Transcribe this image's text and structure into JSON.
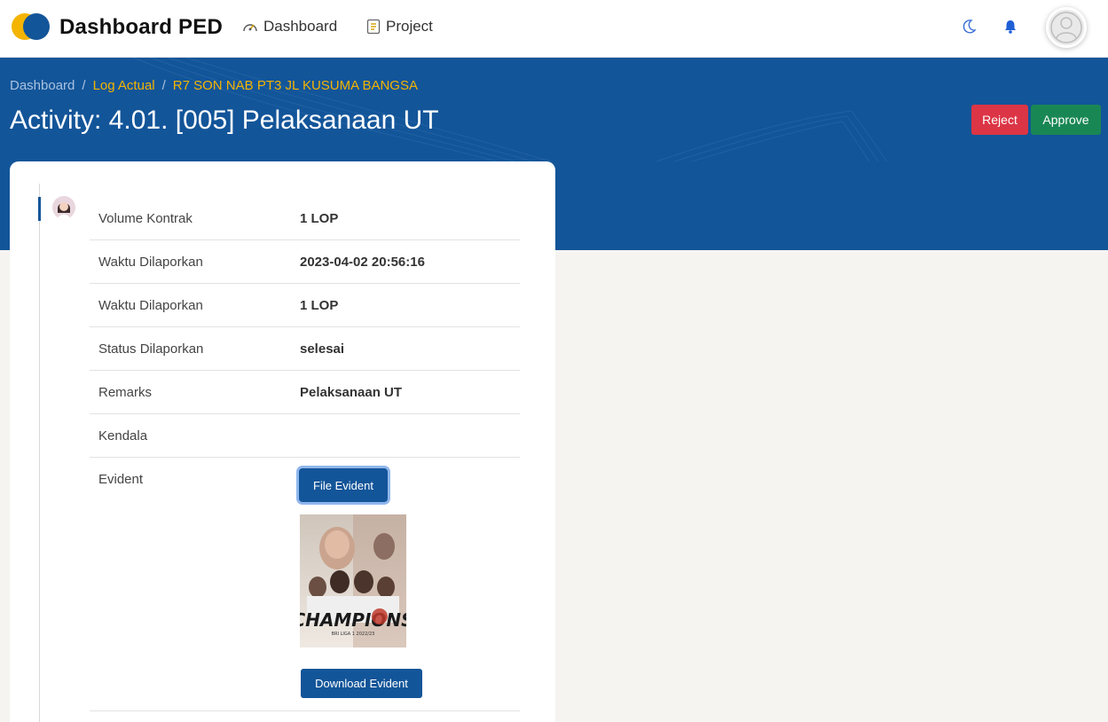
{
  "app": {
    "brand": "Dashboard PED"
  },
  "nav": {
    "dashboard": "Dashboard",
    "project": "Project"
  },
  "breadcrumb": {
    "home": "Dashboard",
    "sep": "/",
    "log": "Log Actual",
    "project": "R7 SON NAB PT3 JL KUSUMA BANGSA"
  },
  "page": {
    "title": "Activity: 4.01. [005] Pelaksanaan UT"
  },
  "actions": {
    "reject": "Reject",
    "approve": "Approve"
  },
  "details": [
    {
      "label": "Volume Kontrak",
      "value": "1 LOP"
    },
    {
      "label": "Waktu Dilaporkan",
      "value": "2023-04-02 20:56:16"
    },
    {
      "label": "Waktu Dilaporkan",
      "value": "1 LOP"
    },
    {
      "label": "Status Dilaporkan",
      "value": "selesai"
    },
    {
      "label": "Remarks",
      "value": "Pelaksanaan UT"
    },
    {
      "label": "Kendala",
      "value": ""
    }
  ],
  "evident": {
    "label": "Evident",
    "file_button": "File Evident",
    "download_button": "Download Evident",
    "image_text": "CHAMPIONS",
    "image_subtext": "BRI LIGA 1 2022/23"
  },
  "colors": {
    "primary": "#135599",
    "reject": "#dc3545",
    "approve": "#198754",
    "accent": "#f4b400"
  },
  "icons": {
    "logo": "logo-icon",
    "moon": "moon-icon",
    "bell": "bell-icon",
    "avatar": "user-avatar-icon"
  }
}
